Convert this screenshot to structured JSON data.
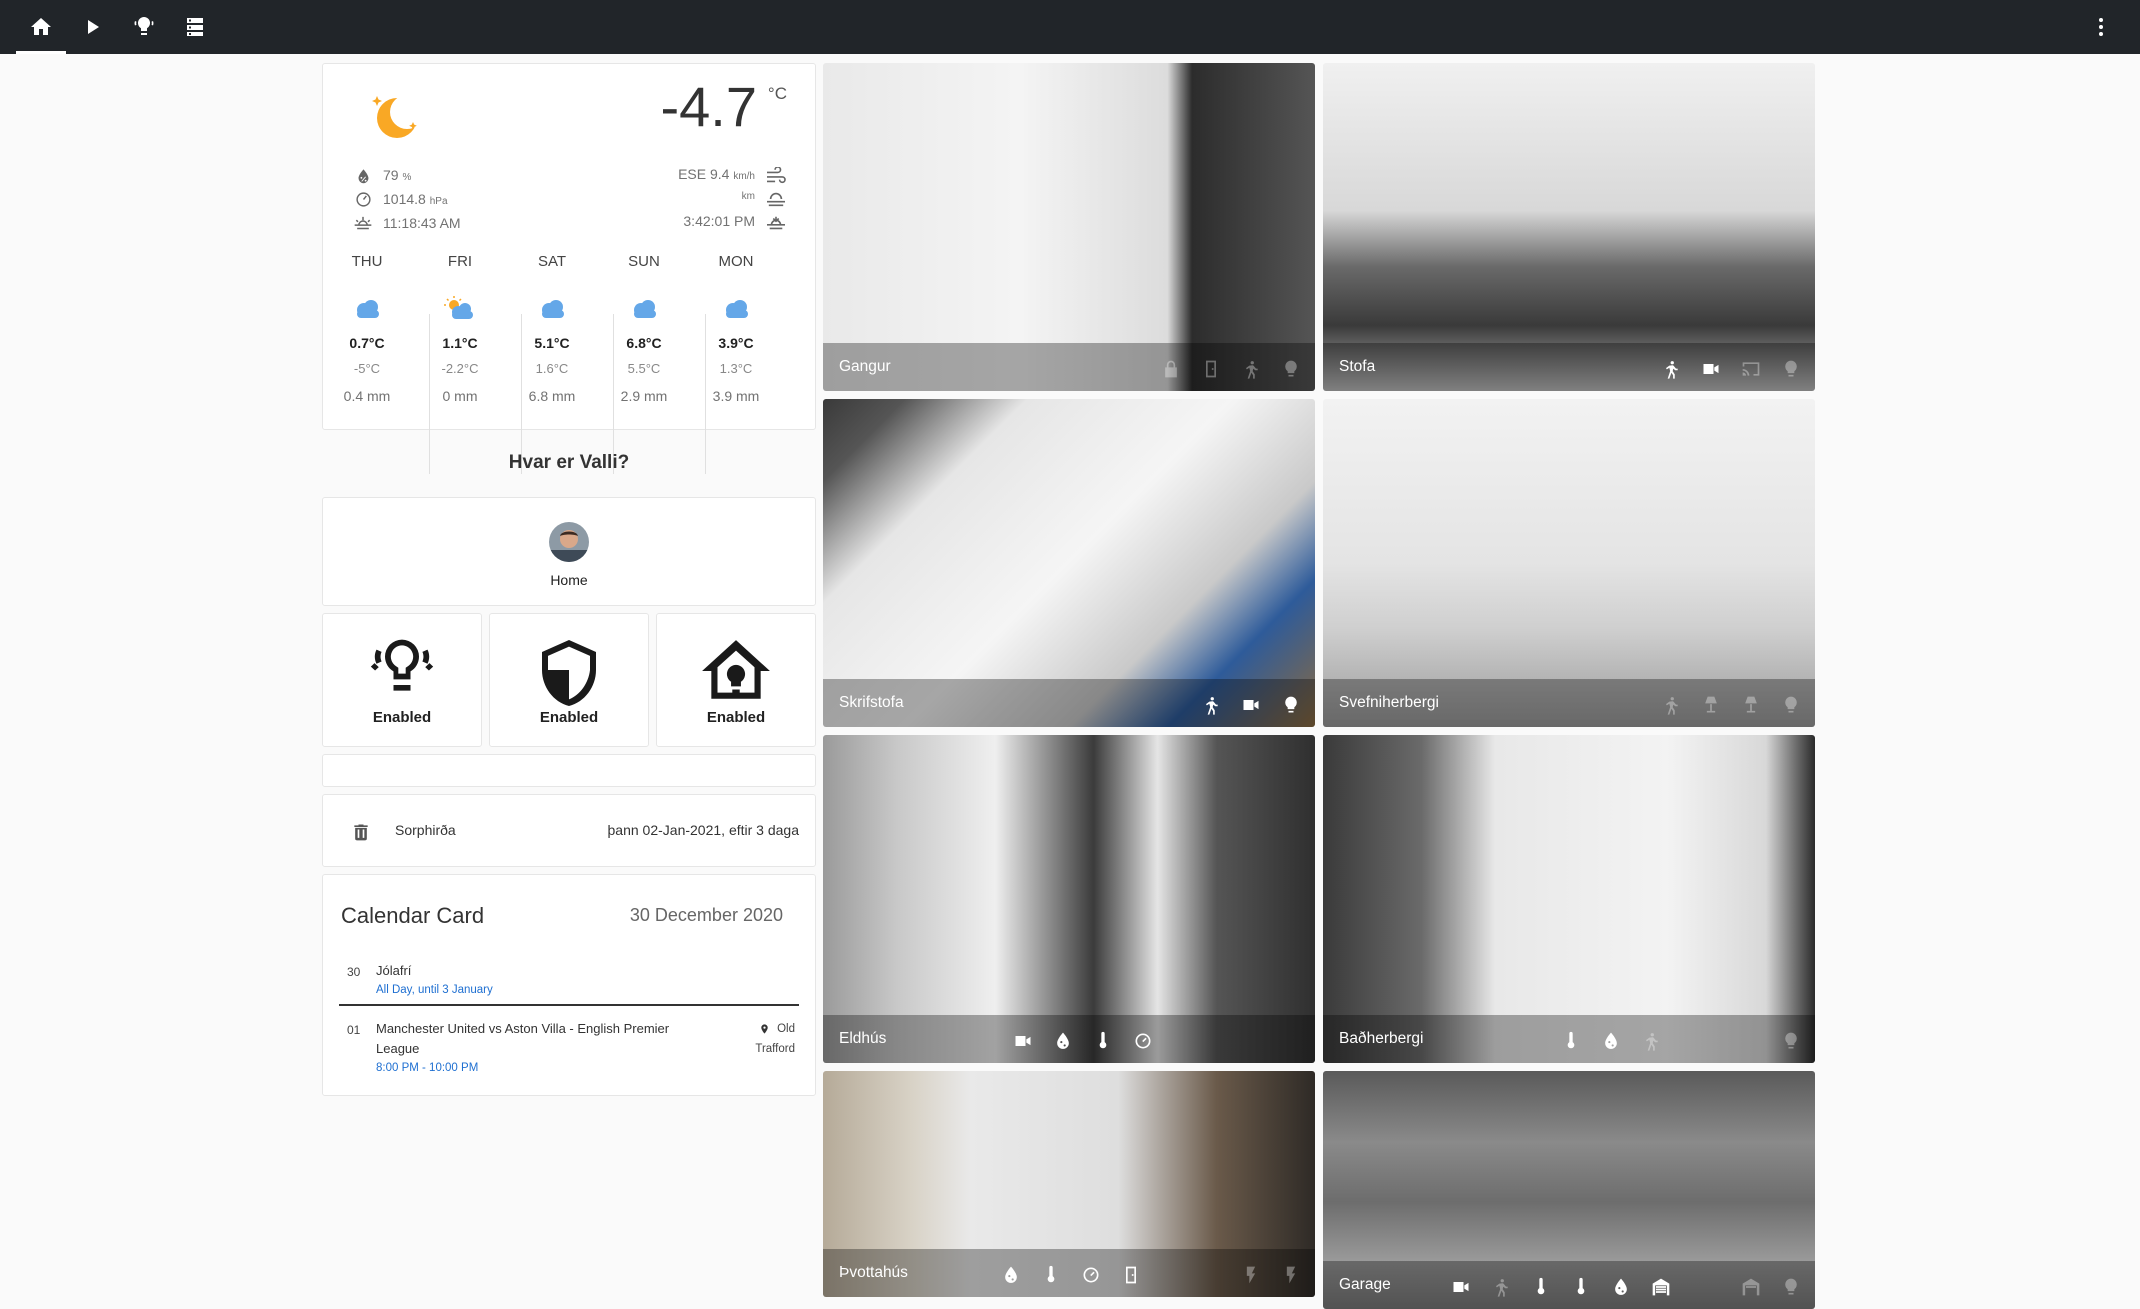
{
  "nav": {
    "tabs": [
      {
        "icon": "home-icon"
      },
      {
        "icon": "play-icon"
      },
      {
        "icon": "lightbulbs-icon"
      },
      {
        "icon": "server-icon"
      }
    ],
    "menu_icon": "dots-vertical-icon"
  },
  "weather": {
    "condition_icon": "moon-clear-night-icon",
    "temperature": "-4.7",
    "unit": "°C",
    "humidity": "79",
    "humidity_unit": "%",
    "pressure": "1014.8",
    "pressure_unit": "hPa",
    "sunrise": "11:18:43 AM",
    "wind": "ESE 9.4",
    "wind_unit": "km/h",
    "visibility_unit": "km",
    "sunset": "3:42:01 PM",
    "forecast": [
      {
        "day": "THU",
        "icon": "cloud-icon",
        "high": "0.7°C",
        "low": "-5°C",
        "precip": "0.4 mm"
      },
      {
        "day": "FRI",
        "icon": "partly-sunny-icon",
        "high": "1.1°C",
        "low": "-2.2°C",
        "precip": "0 mm"
      },
      {
        "day": "SAT",
        "icon": "cloud-icon",
        "high": "5.1°C",
        "low": "1.6°C",
        "precip": "6.8 mm"
      },
      {
        "day": "SUN",
        "icon": "cloud-icon",
        "high": "6.8°C",
        "low": "5.5°C",
        "precip": "2.9 mm"
      },
      {
        "day": "MON",
        "icon": "cloud-icon",
        "high": "3.9°C",
        "low": "1.3°C",
        "precip": "3.9 mm"
      }
    ]
  },
  "presence": {
    "title": "Hvar er Valli?",
    "state": "Home"
  },
  "buttons": [
    {
      "icon": "lightbulbs-icon",
      "label": "Enabled"
    },
    {
      "icon": "shield-half-icon",
      "label": "Enabled"
    },
    {
      "icon": "home-lightbulb-icon",
      "label": "Enabled"
    }
  ],
  "garbage": {
    "icon": "trash-can-icon",
    "name": "Sorphirða",
    "value": "þann 02-Jan-2021, eftir 3 daga"
  },
  "calendar": {
    "title": "Calendar Card",
    "date": "30 December 2020",
    "events": [
      {
        "day": "30",
        "title": "Jólafrí",
        "time": "All Day, until 3 January",
        "location": ""
      },
      {
        "day": "01",
        "title_line1": "Manchester United vs Aston Villa - English Premier",
        "title_line2": "League",
        "time": "8:00 PM - 10:00 PM",
        "location_line1": "Old",
        "location_line2": "Trafford"
      }
    ]
  },
  "rooms": [
    {
      "name": "Gangur",
      "icons": [
        "lock-icon",
        "door-icon",
        "walk-icon",
        "lightbulb-icon"
      ]
    },
    {
      "name": "Stofa",
      "icons": [
        "walk-icon",
        "video-icon",
        "cast-icon",
        "lightbulb-icon"
      ]
    },
    {
      "name": "Skrifstofa",
      "icons": [
        "walk-icon",
        "video-icon",
        "lightbulb-icon"
      ]
    },
    {
      "name": "Svefniherbergi",
      "icons": [
        "walk-icon",
        "lamp-icon",
        "lamp-icon",
        "lightbulb-icon"
      ]
    },
    {
      "name": "Eldhús",
      "icons": [
        "video-icon",
        "water-percent-icon",
        "thermometer-icon",
        "gauge-icon"
      ]
    },
    {
      "name": "Baðherbergi",
      "icons": [
        "thermometer-icon",
        "water-percent-icon",
        "walk-icon",
        "lightbulb-icon"
      ]
    },
    {
      "name": "Þvottahús",
      "icons": [
        "water-percent-icon",
        "thermometer-icon",
        "gauge-icon",
        "door-icon",
        "flash-icon",
        "flash-icon"
      ]
    },
    {
      "name": "Garage",
      "icons": [
        "video-icon",
        "walk-icon",
        "thermometer-icon",
        "thermometer-icon",
        "water-percent-icon",
        "garage-icon",
        "garage-open-icon",
        "lightbulb-icon"
      ]
    }
  ]
}
